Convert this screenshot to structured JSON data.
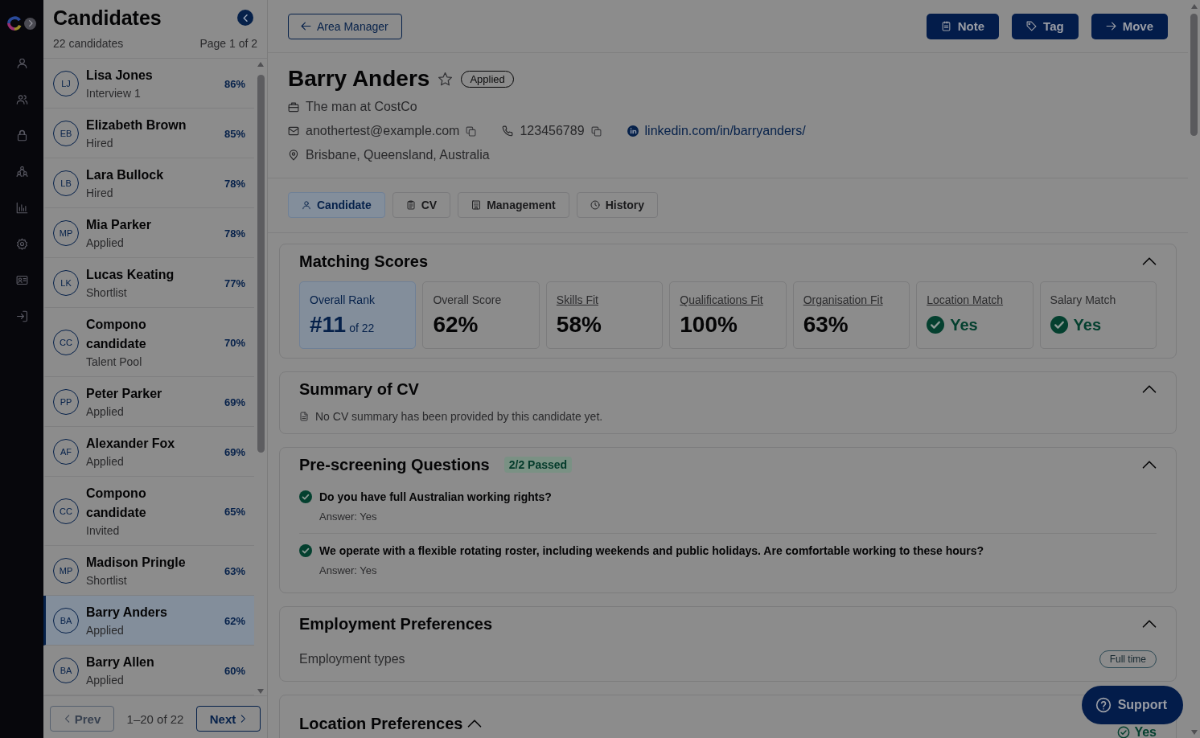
{
  "candidates": {
    "title": "Candidates",
    "count": "22 candidates",
    "page": "Page 1 of 2",
    "items": [
      {
        "initials": "LJ",
        "name": "Lisa Jones",
        "stage": "Interview 1",
        "score": "86%",
        "selected": false
      },
      {
        "initials": "EB",
        "name": "Elizabeth Brown",
        "stage": "Hired",
        "score": "85%",
        "selected": false
      },
      {
        "initials": "LB",
        "name": "Lara Bullock",
        "stage": "Hired",
        "score": "78%",
        "selected": false
      },
      {
        "initials": "MP",
        "name": "Mia Parker",
        "stage": "Applied",
        "score": "78%",
        "selected": false
      },
      {
        "initials": "LK",
        "name": "Lucas Keating",
        "stage": "Shortlist",
        "score": "77%",
        "selected": false
      },
      {
        "initials": "CC",
        "name": "Compono candidate",
        "stage": "Talent Pool",
        "score": "70%",
        "selected": false
      },
      {
        "initials": "PP",
        "name": "Peter Parker",
        "stage": "Applied",
        "score": "69%",
        "selected": false
      },
      {
        "initials": "AF",
        "name": "Alexander Fox",
        "stage": "Applied",
        "score": "69%",
        "selected": false
      },
      {
        "initials": "CC",
        "name": "Compono candidate",
        "stage": "Invited",
        "score": "65%",
        "selected": false
      },
      {
        "initials": "MP",
        "name": "Madison Pringle",
        "stage": "Shortlist",
        "score": "63%",
        "selected": false
      },
      {
        "initials": "BA",
        "name": "Barry Anders",
        "stage": "Applied",
        "score": "62%",
        "selected": true
      },
      {
        "initials": "BA",
        "name": "Barry Allen",
        "stage": "Applied",
        "score": "60%",
        "selected": false
      }
    ],
    "pagination": {
      "prev": {
        "label": "Prev",
        "disabled": true
      },
      "range": "1–20 of 22",
      "next": {
        "label": "Next",
        "disabled": false
      }
    }
  },
  "top_bar": {
    "back_button": "Area Manager",
    "actions": [
      "Note",
      "Tag",
      "Move"
    ]
  },
  "profile": {
    "name": "Barry Anders",
    "starred": false,
    "status": "Applied",
    "headline": "The man at CostCo",
    "email": "anothertest@example.com",
    "phone": "123456789",
    "linkedin": "linkedin.com/in/barryanders/",
    "location": "Brisbane, Queensland, Australia"
  },
  "tabs": [
    {
      "label": "Candidate",
      "selected": true
    },
    {
      "label": "CV",
      "selected": false
    },
    {
      "label": "Management",
      "selected": false
    },
    {
      "label": "History",
      "selected": false
    }
  ],
  "matching_scores": {
    "title": "Matching Scores",
    "expanded": true,
    "tiles": [
      {
        "kind": "rank",
        "label": "Overall Rank",
        "value": "#11",
        "suffix": "of 22",
        "link": false
      },
      {
        "kind": "percent",
        "label": "Overall Score",
        "value": "62%",
        "link": false
      },
      {
        "kind": "percent",
        "label": "Skills Fit",
        "value": "58%",
        "link": true
      },
      {
        "kind": "percent",
        "label": "Qualifications Fit",
        "value": "100%",
        "link": true
      },
      {
        "kind": "percent",
        "label": "Organisation Fit",
        "value": "63%",
        "link": true
      },
      {
        "kind": "check",
        "label": "Location Match",
        "value": "Yes",
        "link": true
      },
      {
        "kind": "check",
        "label": "Salary Match",
        "value": "Yes",
        "link": false
      }
    ]
  },
  "cv_summary": {
    "title": "Summary of CV",
    "expanded": true,
    "text": "No CV summary has been provided by this candidate yet."
  },
  "prescreening": {
    "title": "Pre-screening Questions",
    "badge": "2/2 Passed",
    "expanded": true,
    "questions": [
      {
        "question": "Do you have full Australian working rights?",
        "answer": "Answer: Yes",
        "passed": true
      },
      {
        "question": "We operate with a flexible rotating roster, including weekends and public holidays. Are comfortable working to these hours?",
        "answer": "Answer: Yes",
        "passed": true
      }
    ]
  },
  "employment_preferences": {
    "title": "Employment Preferences",
    "expanded": true,
    "label": "Employment types",
    "tags": [
      "Full time"
    ]
  },
  "location_preferences": {
    "title": "Location Preferences",
    "expanded": true,
    "value": "Yes"
  },
  "support_button": "Support"
}
